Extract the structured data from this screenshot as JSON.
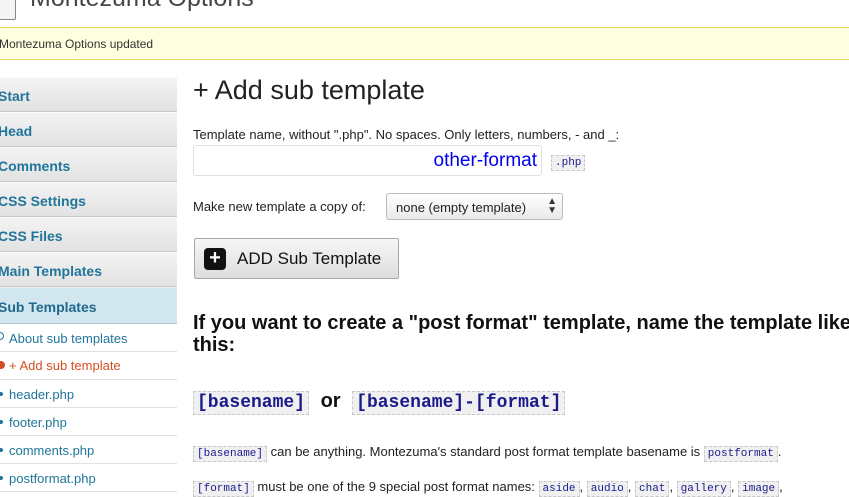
{
  "header": {
    "title": "Montezuma Options"
  },
  "notice": {
    "text": "Montezuma Options updated"
  },
  "sidebar": {
    "items": [
      {
        "label": "Start"
      },
      {
        "label": "Head"
      },
      {
        "label": "Comments"
      },
      {
        "label": "CSS Settings"
      },
      {
        "label": "CSS Files"
      },
      {
        "label": "Main Templates"
      },
      {
        "label": "Sub Templates"
      }
    ],
    "sub_items": [
      {
        "label": "About sub templates"
      },
      {
        "label": "+ Add sub template"
      },
      {
        "label": "header.php"
      },
      {
        "label": "footer.php"
      },
      {
        "label": "comments.php"
      },
      {
        "label": "postformat.php"
      }
    ]
  },
  "main": {
    "heading": "+ Add sub template",
    "name_label": "Template name, without \".php\". No spaces. Only letters, numbers, - and _:",
    "name_value": "other-format",
    "php_suffix": ".php",
    "copy_label": "Make new template a copy of:",
    "copy_selected": "none (empty template)",
    "add_button": "ADD Sub Template",
    "info_heading": "If you want to create a \"post format\" template, name the template like this:",
    "pattern": {
      "part1": "[basename]",
      "or": "or",
      "part2": "[basename]-[format]"
    },
    "basename_line": {
      "code": "[basename]",
      "text": " can be anything. Montezuma's standard post format template basename is ",
      "code2": "postformat",
      "end": "."
    },
    "format_line": {
      "code": "[format]",
      "text": " must be one of the 9 special post format names: ",
      "formats": [
        "aside",
        "audio",
        "chat",
        "gallery",
        "image"
      ]
    }
  }
}
